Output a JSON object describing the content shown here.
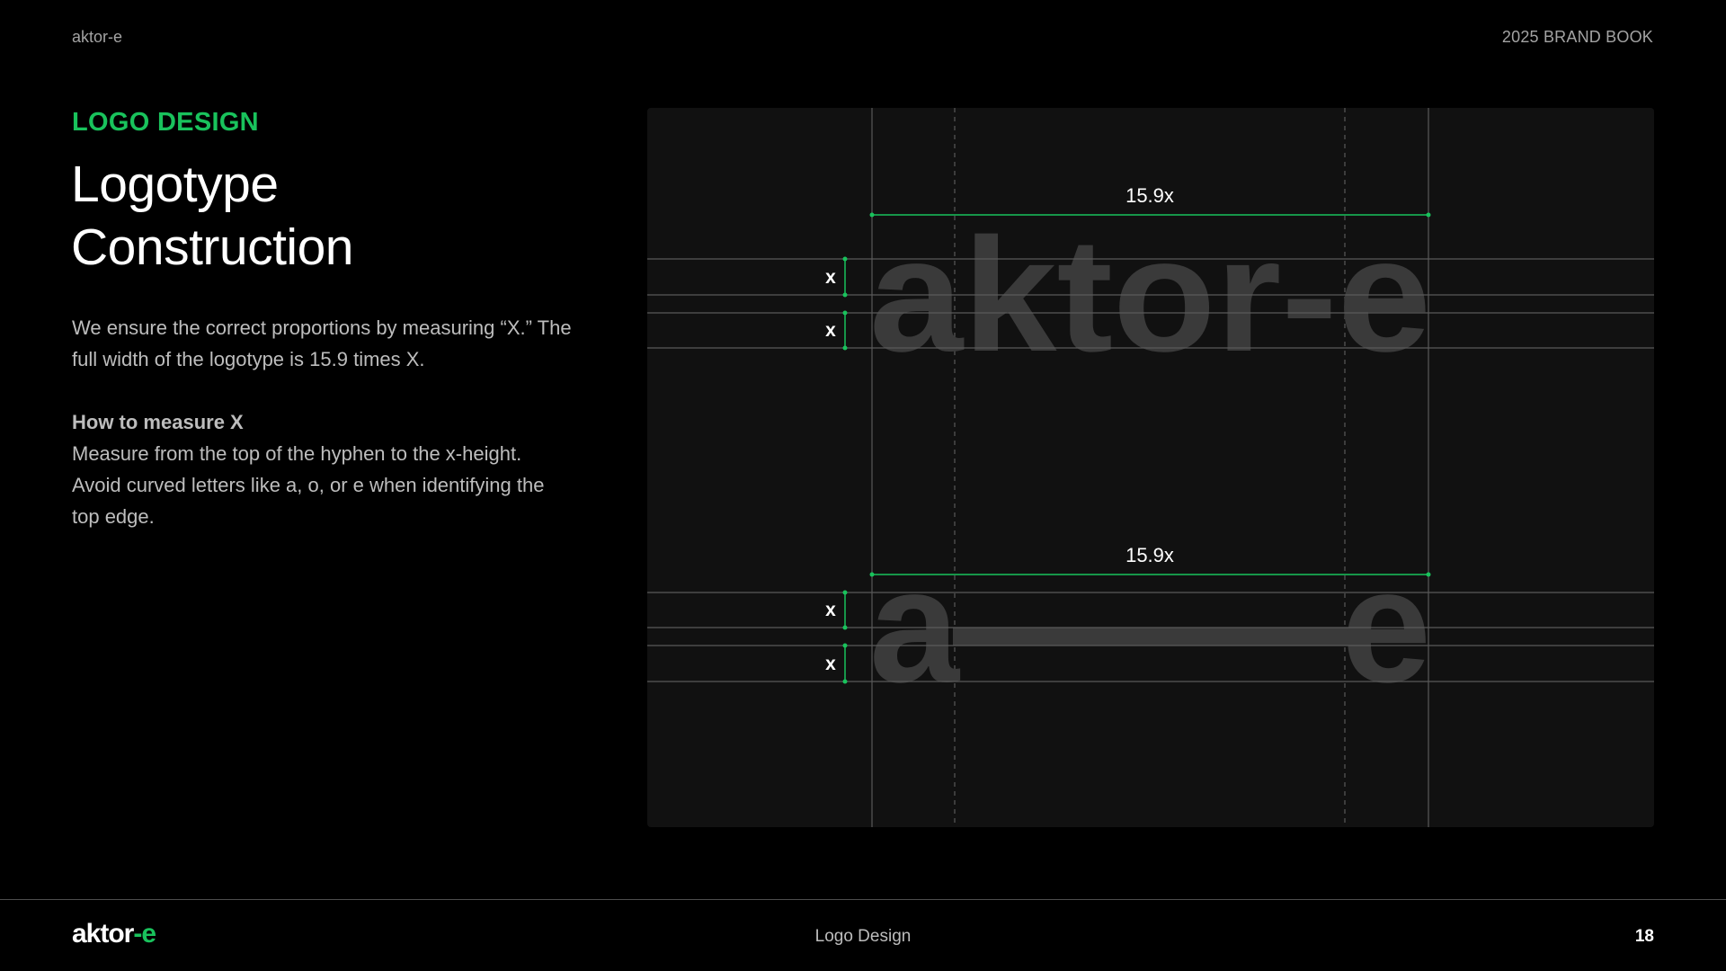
{
  "header": {
    "brand": "aktor-e",
    "book": "2025 BRAND BOOK"
  },
  "content": {
    "kicker": "LOGO DESIGN",
    "title_line1": "Logotype",
    "title_line2": "Construction",
    "paragraph": "We ensure the correct proportions by measuring “X.” The full width of the logotype is 15.9 times X.",
    "subhead": "How to measure X",
    "paragraph2": "Measure from the top of the hyphen to the x-height. Avoid curved letters like a, o, or e when identifying the top edge."
  },
  "diagram": {
    "width_label": "15.9x",
    "unit_label": "x",
    "logo_full": "aktor-e",
    "logo_a": "a",
    "logo_e": "e",
    "colors": {
      "accent": "#19c25c",
      "guide": "#5a5a5a",
      "logo": "#3a3a3a",
      "panel": "#111111"
    }
  },
  "footer": {
    "logo_main": "aktor",
    "logo_accent": "-e",
    "section": "Logo Design",
    "page": "18"
  }
}
